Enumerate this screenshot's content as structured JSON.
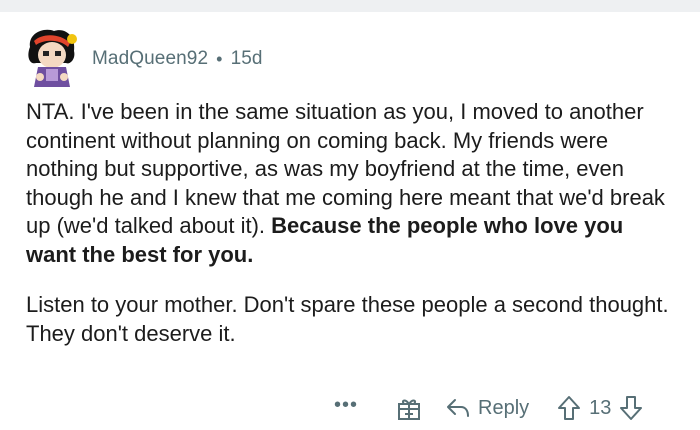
{
  "comment": {
    "author": "MadQueen92",
    "separator": "•",
    "age": "15d",
    "paragraph1_text": "NTA. I've been in the same situation as you, I moved to another continent without planning on coming back. My friends were nothing but supportive, as was my boyfriend at the time, even though he and I knew that me coming here meant that we'd break up (we'd talked about it). ",
    "paragraph1_bold": "Because the people who love you want the best for you.",
    "paragraph2": "Listen to your mother. Don't spare these people a second thought. They don't deserve it."
  },
  "actions": {
    "more_label": "•••",
    "reply_label": "Reply",
    "vote_count": "13",
    "award_icon": "gift-icon",
    "reply_icon": "reply-arrow-icon",
    "upvote_icon": "upvote-arrow-icon",
    "downvote_icon": "downvote-arrow-icon"
  },
  "colors": {
    "meta_text": "#576f76",
    "body_text": "#1c1c1c",
    "top_strip": "#eef0f2"
  }
}
